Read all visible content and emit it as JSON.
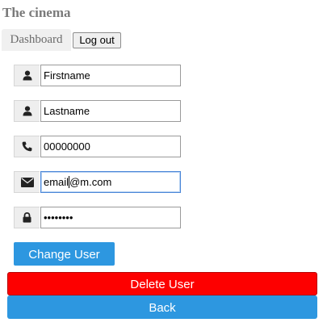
{
  "app": {
    "title": "The cinema"
  },
  "nav": {
    "dashboard_label": "Dashboard",
    "logout_label": "Log out"
  },
  "form": {
    "firstname": {
      "icon": "user-icon",
      "value": "Firstname"
    },
    "lastname": {
      "icon": "user-icon",
      "value": "Lastname"
    },
    "phone": {
      "icon": "phone-icon",
      "value": "00000000"
    },
    "email": {
      "icon": "envelope-icon",
      "value_before_caret": "email",
      "value_after_caret": "@m.com"
    },
    "password": {
      "icon": "lock-icon",
      "value": "••••••••"
    }
  },
  "actions": {
    "change_label": "Change User",
    "delete_label": "Delete User",
    "back_label": "Back"
  },
  "colors": {
    "primary": "#2d97e0",
    "danger": "#fd0000",
    "title": "#7a7a7a"
  }
}
